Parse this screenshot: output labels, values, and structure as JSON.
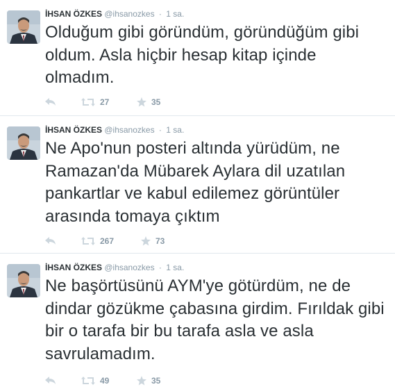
{
  "colors": {
    "text": "#292f33",
    "muted": "#8899a6",
    "divider": "#e1e8ed"
  },
  "tweets": [
    {
      "author": "İHSAN ÖZKES",
      "handle": "@ihsanozkes",
      "separator": "·",
      "time": "1 sa.",
      "text": "Olduğum gibi göründüm, göründüğüm gibi oldum. Asla hiçbir hesap kitap içinde olmadım.",
      "retweets": "27",
      "favorites": "35",
      "icons": [
        "avatar",
        "reply-icon",
        "retweet-icon",
        "star-icon"
      ]
    },
    {
      "author": "İHSAN ÖZKES",
      "handle": "@ihsanozkes",
      "separator": "·",
      "time": "1 sa.",
      "text": "Ne Apo'nun posteri altında yürüdüm, ne Ramazan'da Mübarek Aylara dil uzatılan pankartlar ve kabul edilemez görüntüler arasında tomaya çıktım",
      "retweets": "267",
      "favorites": "73",
      "icons": [
        "avatar",
        "reply-icon",
        "retweet-icon",
        "star-icon"
      ]
    },
    {
      "author": "İHSAN ÖZKES",
      "handle": "@ihsanozkes",
      "separator": "·",
      "time": "1 sa.",
      "text": "Ne başörtüsünü AYM'ye götürdüm, ne de dindar gözükme çabasına girdim. Fırıldak gibi bir o tarafa bir bu tarafa asla ve asla savrulamadım.",
      "retweets": "49",
      "favorites": "35",
      "icons": [
        "avatar",
        "reply-icon",
        "retweet-icon",
        "star-icon"
      ]
    }
  ]
}
